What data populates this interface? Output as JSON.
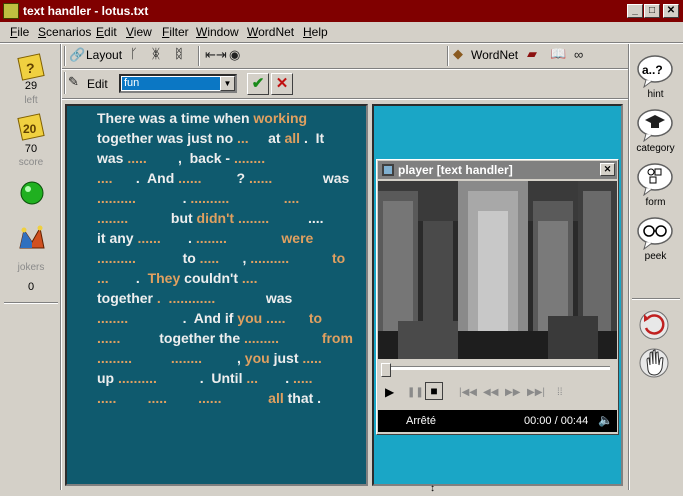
{
  "window": {
    "title": "text handler - lotus.txt"
  },
  "menu": [
    "File",
    "Scenarios",
    "Edit",
    "View",
    "Filter",
    "Window",
    "WordNet",
    "Help"
  ],
  "toolbar": {
    "layout_label": "Layout",
    "wordnet_label": "WordNet",
    "edit_label": "Edit",
    "combo_value": "fun"
  },
  "left_panel": {
    "left_count": "29",
    "left_label": "left",
    "score_value": "70",
    "score_label": "score",
    "jokers_label": "jokers",
    "jokers_count": "0"
  },
  "right_panel": {
    "hint_label": "hint",
    "category_label": "category",
    "form_label": "form",
    "peek_label": "peek"
  },
  "text_lines": [
    [
      [
        "w",
        "There was a time when"
      ],
      [
        "o",
        " working"
      ]
    ],
    [
      [
        "w",
        "together was just no"
      ],
      [
        "o",
        " ...     "
      ],
      [
        "w",
        "at"
      ],
      [
        "o",
        " all"
      ],
      [
        "w",
        " .  It"
      ]
    ],
    [
      [
        "w",
        "was"
      ],
      [
        "o",
        " .....        "
      ],
      [
        "w",
        ",  back -"
      ],
      [
        "o",
        " ........"
      ]
    ],
    [
      [
        "o",
        "....      "
      ],
      [
        "w",
        ".  And"
      ],
      [
        "o",
        " ......         "
      ],
      [
        "w",
        "?"
      ],
      [
        "o",
        " ......             "
      ],
      [
        "w",
        "was"
      ]
    ],
    [
      [
        "o",
        "..........            "
      ],
      [
        "w",
        "."
      ],
      [
        "o",
        " ..........              ...."
      ]
    ],
    [
      [
        "o",
        "........           "
      ],
      [
        "w",
        "but"
      ],
      [
        "o",
        " didn't"
      ],
      [
        "o",
        " ........          "
      ],
      [
        "w",
        "...."
      ]
    ],
    [
      [
        "w",
        "it any"
      ],
      [
        "o",
        " ......       "
      ],
      [
        "w",
        "."
      ],
      [
        "o",
        " ........              "
      ],
      [
        "o",
        "were"
      ]
    ],
    [
      [
        "o",
        "..........            "
      ],
      [
        "w",
        "to"
      ],
      [
        "o",
        " .....      "
      ],
      [
        "w",
        ","
      ],
      [
        "o",
        " ..........           "
      ],
      [
        "o",
        "to"
      ]
    ],
    [
      [
        "o",
        "...       "
      ],
      [
        "w",
        "."
      ],
      [
        "o",
        "  They"
      ],
      [
        "w",
        " couldn't"
      ],
      [
        "o",
        " ...."
      ]
    ],
    [
      [
        "w",
        "together"
      ],
      [
        "o",
        " .  ............             "
      ],
      [
        "w",
        "was"
      ]
    ],
    [
      [
        "o",
        "........              "
      ],
      [
        "w",
        ".  And if"
      ],
      [
        "o",
        " you"
      ],
      [
        "o",
        " .....      "
      ],
      [
        "o",
        "to"
      ]
    ],
    [
      [
        "o",
        "......          "
      ],
      [
        "w",
        "together the"
      ],
      [
        "o",
        " .........           "
      ],
      [
        "o",
        "from"
      ]
    ],
    [
      [
        "o",
        ".........          ........         "
      ],
      [
        "w",
        ","
      ],
      [
        "o",
        " you"
      ],
      [
        "w",
        " just"
      ],
      [
        "o",
        " ....."
      ]
    ],
    [
      [
        "w",
        "up"
      ],
      [
        "o",
        " ..........           "
      ],
      [
        "w",
        ".  Until"
      ],
      [
        "o",
        " ...       "
      ],
      [
        "w",
        "."
      ],
      [
        "o",
        " ....."
      ]
    ],
    [
      [
        "o",
        ".....        .....        ......            "
      ],
      [
        "o",
        "all"
      ],
      [
        "w",
        " that"
      ],
      [
        "w",
        " ."
      ]
    ]
  ],
  "player": {
    "title": "player [text handler]",
    "status_text": "Arrêté",
    "time_text": "00:00 / 00:44"
  },
  "icons": [
    "text-handler-app-icon",
    "minimize-icon",
    "maximize-icon",
    "close-icon",
    "speaker-icon"
  ],
  "colors": {
    "title_bar": "#800000",
    "text_panel": "#0f5a6e",
    "cyan_panel": "#1aa6c6",
    "highlight": "#0b77c4",
    "text_white": "#eeeeee",
    "text_orange": "#e0a060"
  }
}
